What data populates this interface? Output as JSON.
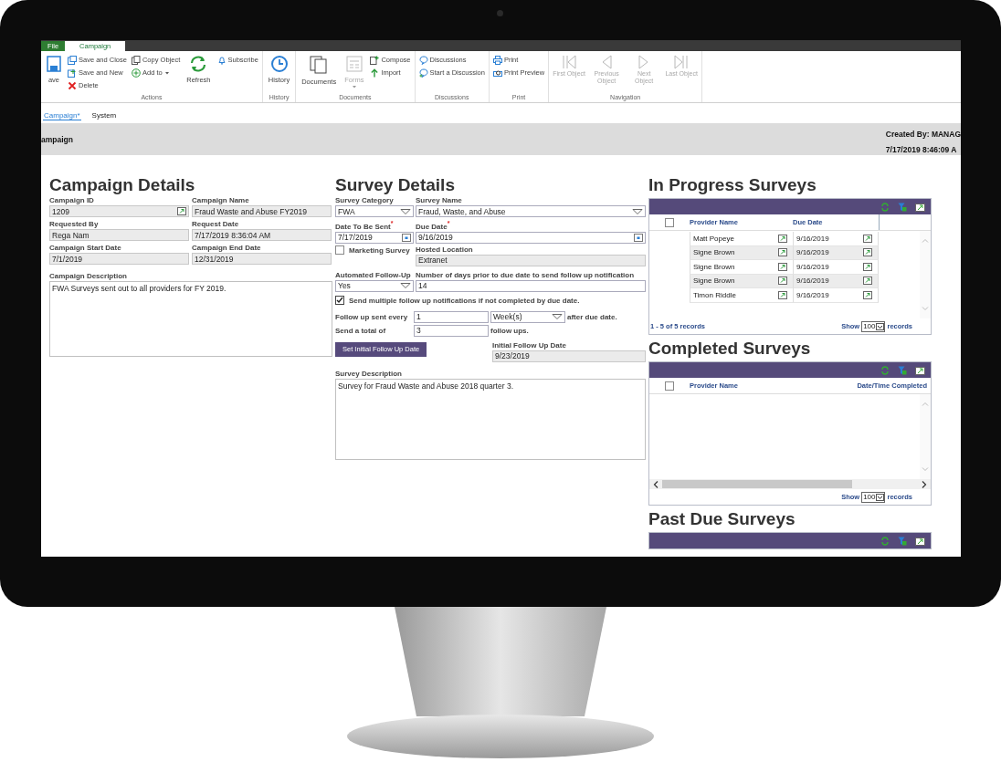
{
  "menu_tabs": [
    {
      "label": "File",
      "selected": false
    },
    {
      "label": "Campaign",
      "selected": true
    }
  ],
  "ribbon": {
    "actions": {
      "label": "Actions",
      "save": "ave",
      "save_and_close": "Save and Close",
      "save_and_new": "Save and New",
      "delete": "Delete",
      "copy_object": "Copy Object",
      "add_to": "Add to",
      "refresh": "Refresh",
      "subscribe": "Subscribe"
    },
    "history": {
      "label": "History",
      "history": "History"
    },
    "documents": {
      "label": "Documents",
      "documents": "Documents",
      "forms": {
        "label": "Forms",
        "disabled": true
      },
      "compose": "Compose",
      "import": "Import"
    },
    "discussions": {
      "label": "Discussions",
      "discussions": "Discussions",
      "start": "Start a Discussion"
    },
    "print": {
      "label": "Print",
      "print": "Print",
      "print_preview": "Print Preview"
    },
    "navigation": {
      "label": "Navigation",
      "buttons": [
        {
          "label": "First Object",
          "disabled": true
        },
        {
          "label": "Previous Object",
          "disabled": true
        },
        {
          "label": "Next Object",
          "disabled": true
        },
        {
          "label": "Last Object",
          "disabled": true
        }
      ]
    }
  },
  "page_tabs": [
    {
      "label": "Campaign*",
      "selected": true
    },
    {
      "label": "System",
      "selected": false
    }
  ],
  "header": {
    "title": "ampaign",
    "created_by": "Created By: MANAG",
    "created_at": "7/17/2019 8:46:09 A"
  },
  "campaign_details": {
    "heading": "Campaign Details",
    "fields": [
      {
        "label": "Campaign ID",
        "value": "1209",
        "kind": "lookup"
      },
      {
        "label": "Campaign Name",
        "value": "Fraud Waste and Abuse FY2019",
        "kind": "text"
      },
      {
        "label": "Requested By",
        "value": "Rega Nam",
        "kind": "text"
      },
      {
        "label": "Request Date",
        "value": "7/17/2019 8:36:04 AM",
        "kind": "text"
      },
      {
        "label": "Campaign Start Date",
        "value": "7/1/2019",
        "kind": "text"
      },
      {
        "label": "Campaign End Date",
        "value": "12/31/2019",
        "kind": "text"
      }
    ],
    "description": {
      "label": "Campaign Description",
      "value": "FWA Surveys sent out to all providers for FY 2019."
    }
  },
  "survey_details": {
    "heading": "Survey Details",
    "survey_category": {
      "label": "Survey Category",
      "value": "FWA"
    },
    "survey_name": {
      "label": "Survey Name",
      "value": "Fraud, Waste, and Abuse"
    },
    "date_to_be_sent": {
      "label": "Date To Be Sent",
      "required_mark": "*",
      "value": "7/17/2019"
    },
    "due_date": {
      "label": "Due Date",
      "required_mark": "*",
      "value": "9/16/2019"
    },
    "marketing_survey": {
      "label": "Marketing Survey",
      "checked": false
    },
    "hosted_location": {
      "label": "Hosted Location",
      "value": "Extranet"
    },
    "automated_follow_up": {
      "label": "Automated Follow-Up",
      "value": "Yes"
    },
    "days_prior": {
      "label": "Number of days prior to due date to send follow up notification",
      "value": "14"
    },
    "send_multiple": {
      "label": "Send multiple follow up notifications if not completed by due date.",
      "checked": true
    },
    "follow_up_every": {
      "label": "Follow up sent every",
      "value": "1",
      "unit": "Week(s)",
      "suffix": "after due date."
    },
    "send_total": {
      "label": "Send a total of",
      "value": "3",
      "suffix": "follow ups."
    },
    "set_initial_button": "Set Initial Follow Up Date",
    "initial_follow_up_date": {
      "label": "Initial Follow Up Date",
      "value": "9/23/2019"
    },
    "survey_description": {
      "label": "Survey Description",
      "value": "Survey for Fraud Waste and Abuse 2018 quarter 3."
    }
  },
  "in_progress": {
    "heading": "In Progress Surveys",
    "select_all_checked": false,
    "columns": [
      "Provider Name",
      "Due Date"
    ],
    "rows": [
      {
        "provider_name": "Matt Popeye",
        "due_date": "9/16/2019"
      },
      {
        "provider_name": "Signe Brown",
        "due_date": "9/16/2019"
      },
      {
        "provider_name": "Signe Brown",
        "due_date": "9/16/2019"
      },
      {
        "provider_name": "Signe Brown",
        "due_date": "9/16/2019"
      },
      {
        "provider_name": "Timon Riddle",
        "due_date": "9/16/2019"
      }
    ],
    "pager": {
      "range": "1 - 5 of 5 records",
      "show": "Show",
      "page_size": "100",
      "records": "records"
    }
  },
  "completed": {
    "heading": "Completed Surveys",
    "select_all_checked": false,
    "columns": [
      "Provider Name",
      "Date/Time Completed"
    ],
    "pager": {
      "show": "Show",
      "page_size": "100",
      "records": "records"
    }
  },
  "past_due": {
    "heading": "Past Due Surveys"
  }
}
